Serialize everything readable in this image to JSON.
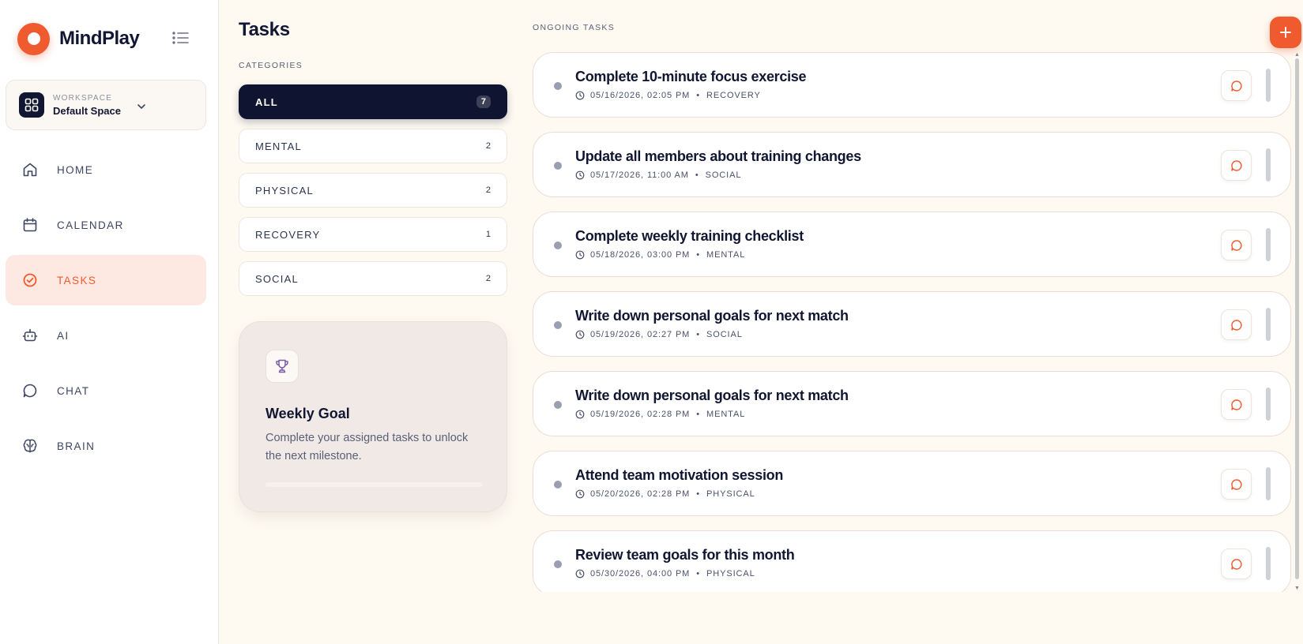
{
  "brand": {
    "name": "MindPlay",
    "accent": "#ef5a2e",
    "dark": "#111632"
  },
  "workspace": {
    "label": "WORKSPACE",
    "name": "Default Space"
  },
  "nav": [
    {
      "label": "HOME",
      "icon": "home-icon",
      "active": false
    },
    {
      "label": "CALENDAR",
      "icon": "calendar-icon",
      "active": false
    },
    {
      "label": "TASKS",
      "icon": "check-circle-icon",
      "active": true
    },
    {
      "label": "AI",
      "icon": "robot-icon",
      "active": false
    },
    {
      "label": "CHAT",
      "icon": "chat-bubble-icon",
      "active": false
    },
    {
      "label": "BRAIN",
      "icon": "brain-icon",
      "active": false
    }
  ],
  "page": {
    "title": "Tasks"
  },
  "categories": {
    "heading": "CATEGORIES",
    "items": [
      {
        "label": "ALL",
        "count": "7",
        "active": true
      },
      {
        "label": "MENTAL",
        "count": "2",
        "active": false
      },
      {
        "label": "PHYSICAL",
        "count": "2",
        "active": false
      },
      {
        "label": "RECOVERY",
        "count": "1",
        "active": false
      },
      {
        "label": "SOCIAL",
        "count": "2",
        "active": false
      }
    ]
  },
  "goal": {
    "icon": "trophy-icon",
    "title": "Weekly Goal",
    "description": "Complete your assigned tasks to unlock the next milestone.",
    "progress": 0
  },
  "tasks": {
    "heading": "ONGOING TASKS",
    "items": [
      {
        "title": "Complete 10-minute focus exercise",
        "datetime": "05/16/2026, 02:05 PM",
        "category": "RECOVERY"
      },
      {
        "title": "Update all members about training changes",
        "datetime": "05/17/2026, 11:00 AM",
        "category": "SOCIAL"
      },
      {
        "title": "Complete weekly training checklist",
        "datetime": "05/18/2026, 03:00 PM",
        "category": "MENTAL"
      },
      {
        "title": "Write down personal goals for next match",
        "datetime": "05/19/2026, 02:27 PM",
        "category": "SOCIAL"
      },
      {
        "title": "Write down personal goals for next match",
        "datetime": "05/19/2026, 02:28 PM",
        "category": "MENTAL"
      },
      {
        "title": "Attend team motivation session",
        "datetime": "05/20/2026, 02:28 PM",
        "category": "PHYSICAL"
      },
      {
        "title": "Review team goals for this month",
        "datetime": "05/30/2026, 04:00 PM",
        "category": "PHYSICAL"
      }
    ]
  }
}
